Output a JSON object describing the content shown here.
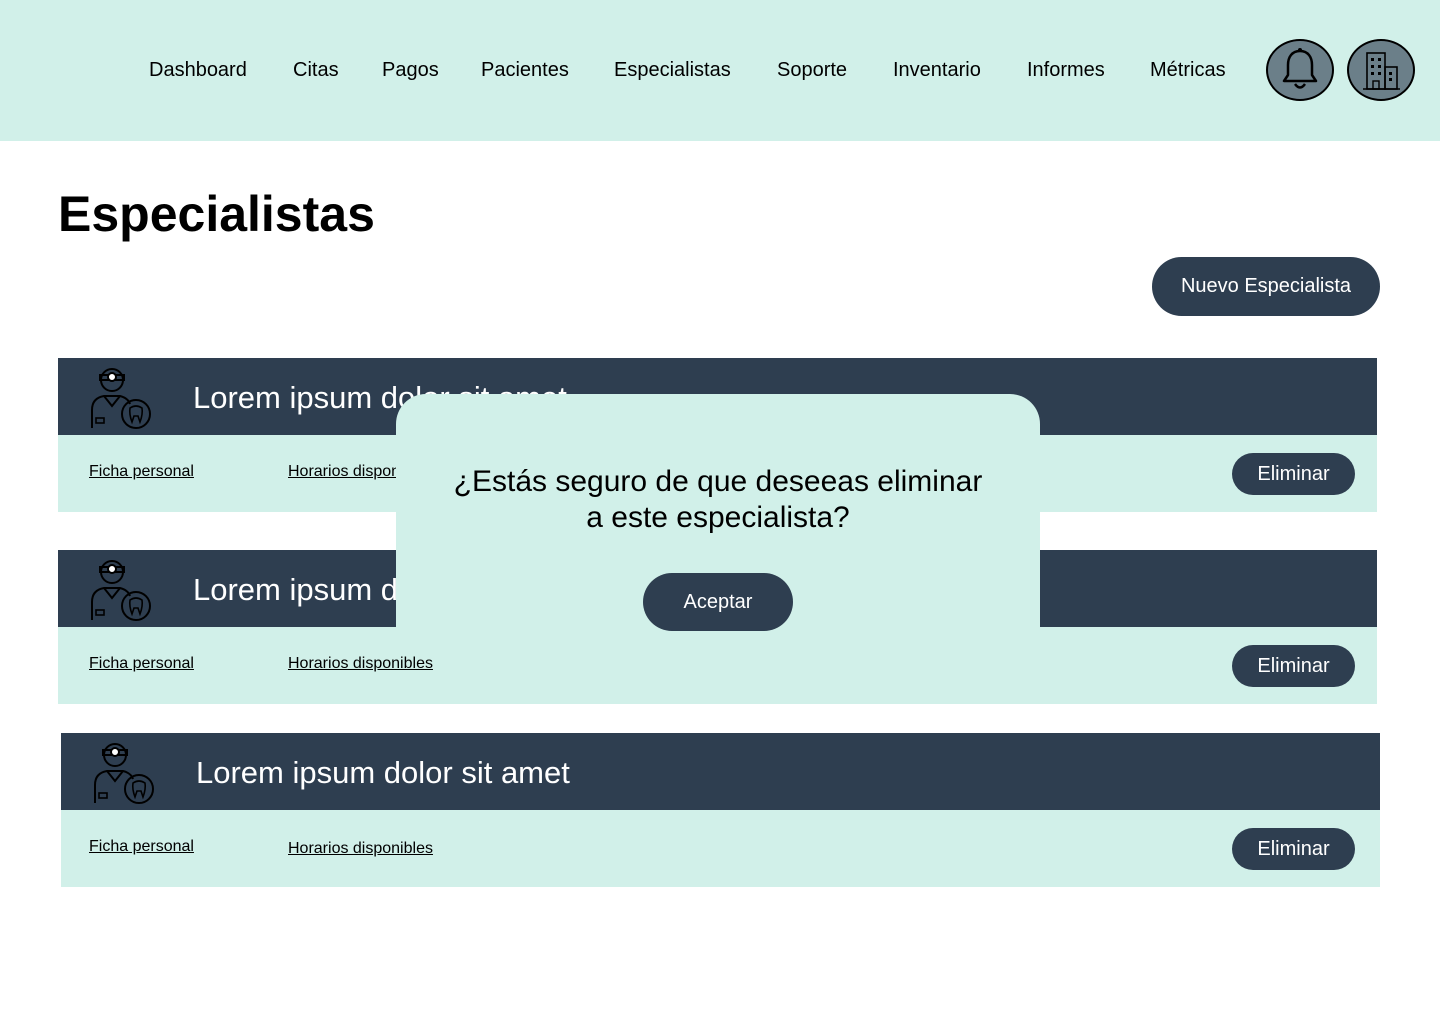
{
  "nav": {
    "items": [
      "Dashboard",
      "Citas",
      "Pagos",
      "Pacientes",
      "Especialistas",
      "Soporte",
      "Inventario",
      "Informes",
      "Métricas"
    ],
    "icons": [
      "bell-icon",
      "building-icon"
    ]
  },
  "page": {
    "title": "Especialistas",
    "new_button": "Nuevo Especialista"
  },
  "cards": [
    {
      "name": "Lorem ipsum dolor sit amet",
      "link_personal": "Ficha personal",
      "link_schedule": "Horarios disponibles",
      "delete_label": "Eliminar",
      "icon": "dentist-icon"
    },
    {
      "name": "Lorem ipsum dolor sit amet",
      "link_personal": "Ficha personal",
      "link_schedule": "Horarios disponibles",
      "delete_label": "Eliminar",
      "icon": "dentist-icon"
    },
    {
      "name": "Lorem ipsum dolor sit amet",
      "link_personal": "Ficha personal",
      "link_schedule": "Horarios disponibles",
      "delete_label": "Eliminar",
      "icon": "dentist-icon"
    }
  ],
  "modal": {
    "line1": "¿Estás seguro de que  deseeas eliminar",
    "line2": "a este especialista?",
    "accept": "Aceptar"
  },
  "colors": {
    "mint": "#d1f0e9",
    "navy": "#2e3e50",
    "icon_bg": "#6b7f89"
  }
}
